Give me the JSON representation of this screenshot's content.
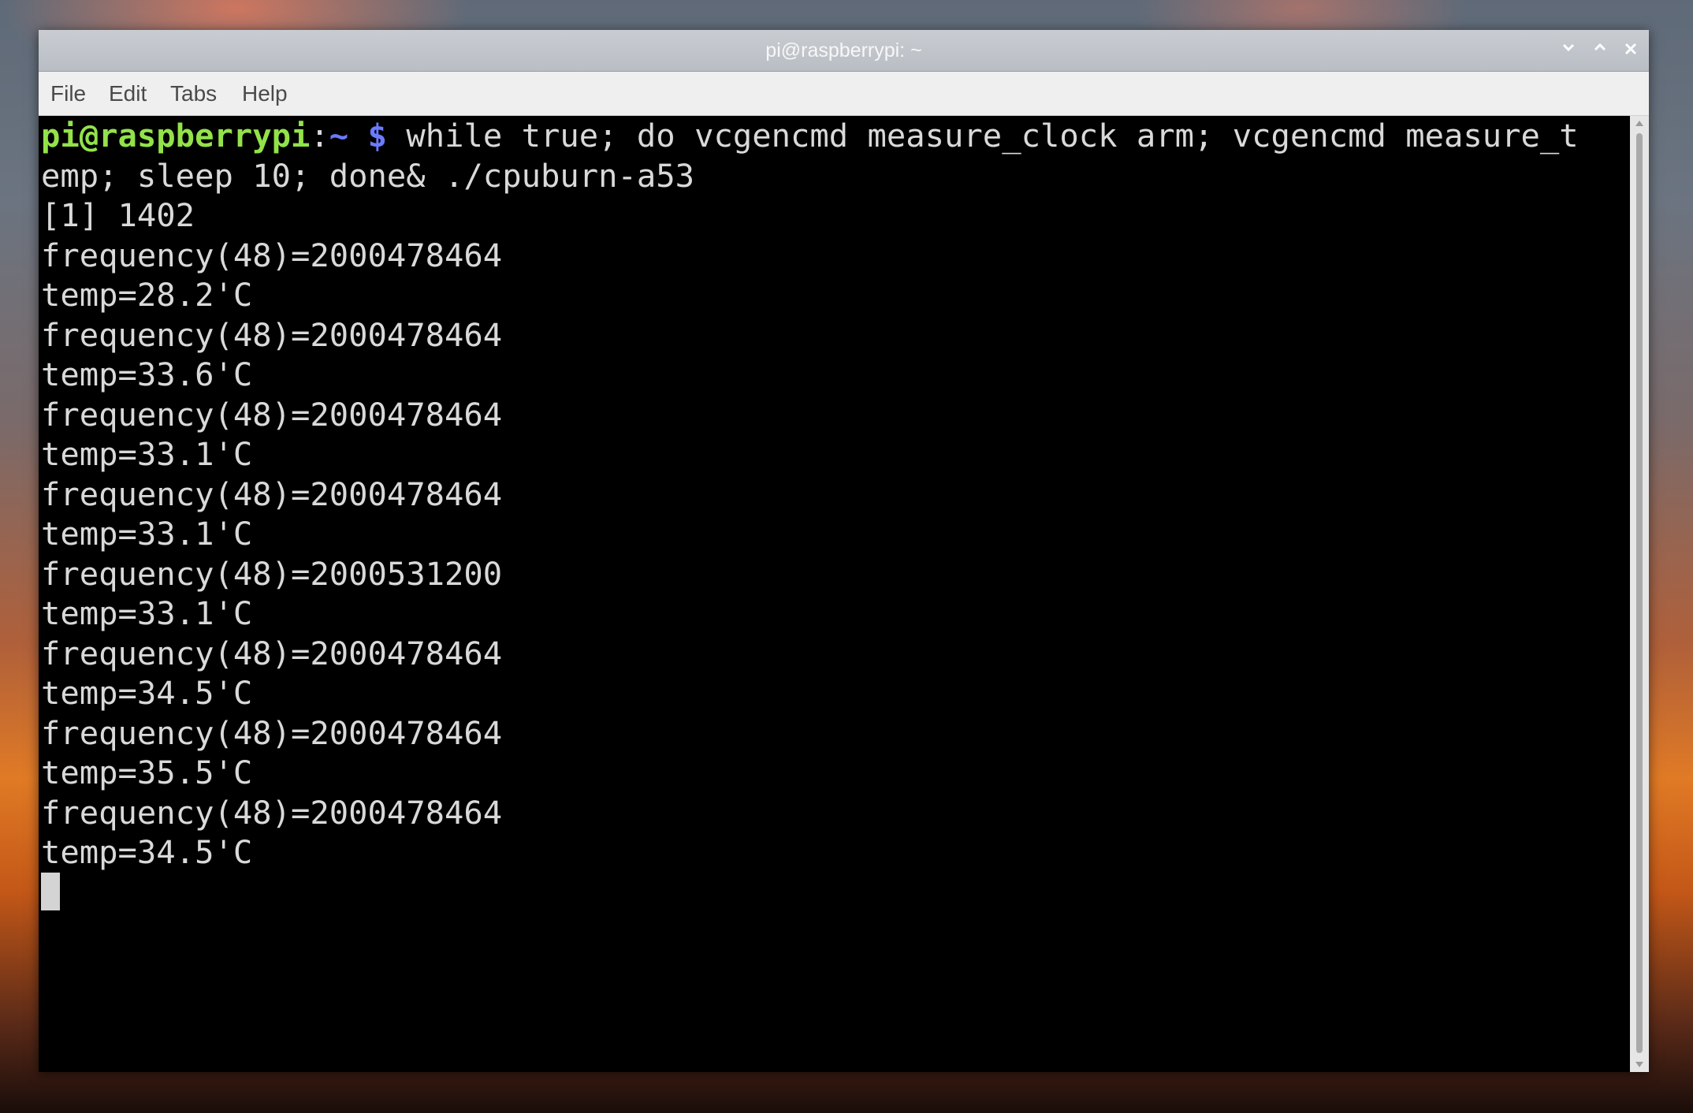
{
  "window": {
    "title": "pi@raspberrypi: ~",
    "controls": {
      "minimize_icon": "chevron-down-icon",
      "maximize_icon": "chevron-up-icon",
      "close_icon": "close-icon"
    }
  },
  "menubar": {
    "items": [
      "File",
      "Edit",
      "Tabs",
      "Help"
    ]
  },
  "terminal": {
    "prompt": {
      "user_host": "pi@raspberrypi",
      "colon": ":",
      "path": "~",
      "symbol": "$"
    },
    "command_line_1": " while true; do vcgencmd measure_clock arm; vcgencmd measure_t",
    "command_line_2": "emp; sleep 10; done& ./cpuburn-a53",
    "output": [
      "[1] 1402",
      "frequency(48)=2000478464",
      "temp=28.2'C",
      "frequency(48)=2000478464",
      "temp=33.6'C",
      "frequency(48)=2000478464",
      "temp=33.1'C",
      "frequency(48)=2000478464",
      "temp=33.1'C",
      "frequency(48)=2000531200",
      "temp=33.1'C",
      "frequency(48)=2000478464",
      "temp=34.5'C",
      "frequency(48)=2000478464",
      "temp=35.5'C",
      "frequency(48)=2000478464",
      "temp=34.5'C"
    ]
  },
  "colors": {
    "prompt_user": "#93e24a",
    "prompt_path": "#6b7bff",
    "terminal_text": "#d9d9d9",
    "terminal_bg": "#000000"
  }
}
